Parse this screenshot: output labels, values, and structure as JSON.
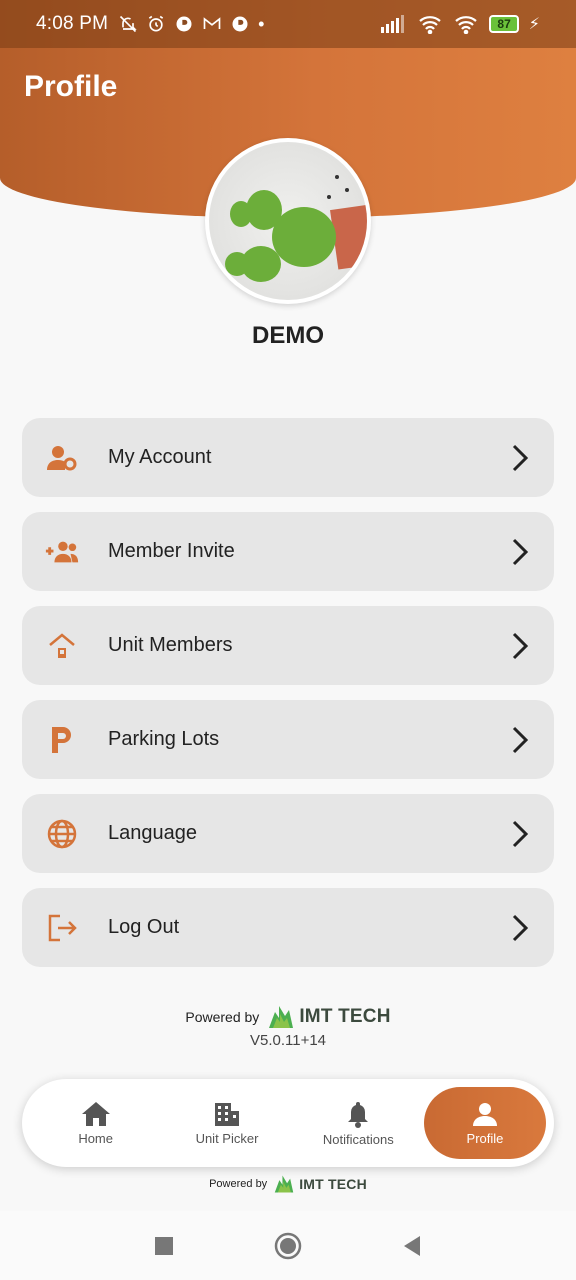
{
  "status_bar": {
    "time": "4:08 PM",
    "battery": "87"
  },
  "header": {
    "title": "Profile"
  },
  "profile": {
    "username": "DEMO"
  },
  "menu": [
    {
      "label": "My Account",
      "icon": "account-settings-icon"
    },
    {
      "label": "Member Invite",
      "icon": "add-members-icon"
    },
    {
      "label": "Unit Members",
      "icon": "home-icon"
    },
    {
      "label": "Parking Lots",
      "icon": "parking-icon"
    },
    {
      "label": "Language",
      "icon": "globe-icon"
    },
    {
      "label": "Log Out",
      "icon": "logout-icon"
    }
  ],
  "footer": {
    "powered_by": "Powered by",
    "brand": "IMT TECH",
    "version": "V5.0.11+14"
  },
  "bottom_nav": [
    {
      "label": "Home",
      "icon": "home-icon"
    },
    {
      "label": "Unit Picker",
      "icon": "building-icon"
    },
    {
      "label": "Notifications",
      "icon": "bell-icon"
    },
    {
      "label": "Profile",
      "icon": "person-icon",
      "active": true
    }
  ],
  "colors": {
    "accent": "#d4743a",
    "brand_green": "#4caf50"
  }
}
